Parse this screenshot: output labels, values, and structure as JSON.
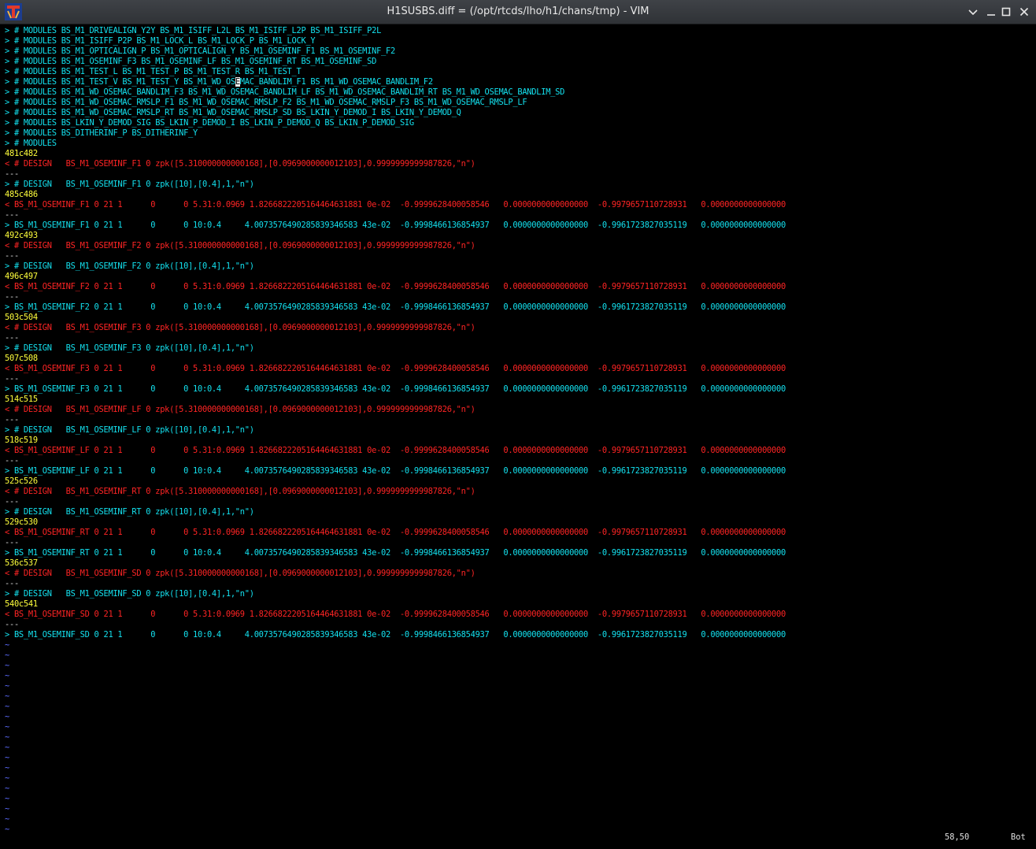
{
  "window": {
    "title": "H1SUSBS.diff = (/opt/rtcds/lho/h1/chans/tmp) - VIM"
  },
  "colors": {
    "added": "#13e1ef",
    "removed": "#ff2424",
    "hunk": "#ffff3c",
    "tilde": "#5c6cff"
  },
  "lines": [
    {
      "type": "add",
      "text": "> # MODULES BS_M1_DRIVEALIGN_Y2Y BS_M1_ISIFF_L2L BS_M1_ISIFF_L2P BS_M1_ISIFF_P2L"
    },
    {
      "type": "add",
      "text": "> # MODULES BS_M1_ISIFF_P2P BS_M1_LOCK_L BS_M1_LOCK_P BS_M1_LOCK_Y"
    },
    {
      "type": "add",
      "text": "> # MODULES BS_M1_OPTICALIGN_P BS_M1_OPTICALIGN_Y BS_M1_OSEMINF_F1 BS_M1_OSEMINF_F2"
    },
    {
      "type": "add",
      "text": "> # MODULES BS_M1_OSEMINF_F3 BS_M1_OSEMINF_LF BS_M1_OSEMINF_RT BS_M1_OSEMINF_SD"
    },
    {
      "type": "add",
      "text": "> # MODULES BS_M1_TEST_L BS_M1_TEST_P BS_M1_TEST_R BS_M1_TEST_T"
    },
    {
      "type": "add",
      "text": "> # MODULES BS_M1_TEST_V BS_M1_TEST_Y BS_M1_WD_OSEMAC_BANDLIM_F1 BS_M1_WD_OSEMAC_BANDLIM_F2",
      "cursor": true,
      "pre": "> # MODULES BS_M1_TEST_V BS_M1_TEST_Y BS_M1_WD_OS",
      "cur": "E",
      "post": "MAC_BANDLIM_F1 BS_M1_WD_OSEMAC_BANDLIM_F2"
    },
    {
      "type": "add",
      "text": "> # MODULES BS_M1_WD_OSEMAC_BANDLIM_F3 BS_M1_WD_OSEMAC_BANDLIM_LF BS_M1_WD_OSEMAC_BANDLIM_RT BS_M1_WD_OSEMAC_BANDLIM_SD"
    },
    {
      "type": "add",
      "text": "> # MODULES BS_M1_WD_OSEMAC_RMSLP_F1 BS_M1_WD_OSEMAC_RMSLP_F2 BS_M1_WD_OSEMAC_RMSLP_F3 BS_M1_WD_OSEMAC_RMSLP_LF"
    },
    {
      "type": "add",
      "text": "> # MODULES BS_M1_WD_OSEMAC_RMSLP_RT BS_M1_WD_OSEMAC_RMSLP_SD BS_LKIN_Y_DEMOD_I BS_LKIN_Y_DEMOD_Q"
    },
    {
      "type": "add",
      "text": "> # MODULES BS_LKIN_Y_DEMOD_SIG BS_LKIN_P_DEMOD_I BS_LKIN_P_DEMOD_Q BS_LKIN_P_DEMOD_SIG"
    },
    {
      "type": "add",
      "text": "> # MODULES BS_DITHERINF_P BS_DITHERINF_Y"
    },
    {
      "type": "add",
      "text": "> # MODULES"
    },
    {
      "type": "hunk",
      "text": "481c482"
    },
    {
      "type": "del",
      "text": "< # DESIGN   BS_M1_OSEMINF_F1 0 zpk([5.310000000000168],[0.0969000000012103],0.9999999999987826,\"n\")"
    },
    {
      "type": "sep",
      "text": "---"
    },
    {
      "type": "add",
      "text": "> # DESIGN   BS_M1_OSEMINF_F1 0 zpk([10],[0.4],1,\"n\")"
    },
    {
      "type": "hunk",
      "text": "485c486"
    },
    {
      "type": "del",
      "text": "< BS_M1_OSEMINF_F1 0 21 1      0      0 5.31:0.0969 1.8266822205164464631881 0e-02  -0.9999628400058546   0.0000000000000000  -0.9979657110728931   0.0000000000000000"
    },
    {
      "type": "sep",
      "text": "---"
    },
    {
      "type": "add",
      "text": "> BS_M1_OSEMINF_F1 0 21 1      0      0 10:0.4     4.0073576490285839346583 43e-02  -0.9998466136854937   0.0000000000000000  -0.9961723827035119   0.0000000000000000"
    },
    {
      "type": "hunk",
      "text": "492c493"
    },
    {
      "type": "del",
      "text": "< # DESIGN   BS_M1_OSEMINF_F2 0 zpk([5.310000000000168],[0.0969000000012103],0.9999999999987826,\"n\")"
    },
    {
      "type": "sep",
      "text": "---"
    },
    {
      "type": "add",
      "text": "> # DESIGN   BS_M1_OSEMINF_F2 0 zpk([10],[0.4],1,\"n\")"
    },
    {
      "type": "hunk",
      "text": "496c497"
    },
    {
      "type": "del",
      "text": "< BS_M1_OSEMINF_F2 0 21 1      0      0 5.31:0.0969 1.8266822205164464631881 0e-02  -0.9999628400058546   0.0000000000000000  -0.9979657110728931   0.0000000000000000"
    },
    {
      "type": "sep",
      "text": "---"
    },
    {
      "type": "add",
      "text": "> BS_M1_OSEMINF_F2 0 21 1      0      0 10:0.4     4.0073576490285839346583 43e-02  -0.9998466136854937   0.0000000000000000  -0.9961723827035119   0.0000000000000000"
    },
    {
      "type": "hunk",
      "text": "503c504"
    },
    {
      "type": "del",
      "text": "< # DESIGN   BS_M1_OSEMINF_F3 0 zpk([5.310000000000168],[0.0969000000012103],0.9999999999987826,\"n\")"
    },
    {
      "type": "sep",
      "text": "---"
    },
    {
      "type": "add",
      "text": "> # DESIGN   BS_M1_OSEMINF_F3 0 zpk([10],[0.4],1,\"n\")"
    },
    {
      "type": "hunk",
      "text": "507c508"
    },
    {
      "type": "del",
      "text": "< BS_M1_OSEMINF_F3 0 21 1      0      0 5.31:0.0969 1.8266822205164464631881 0e-02  -0.9999628400058546   0.0000000000000000  -0.9979657110728931   0.0000000000000000"
    },
    {
      "type": "sep",
      "text": "---"
    },
    {
      "type": "add",
      "text": "> BS_M1_OSEMINF_F3 0 21 1      0      0 10:0.4     4.0073576490285839346583 43e-02  -0.9998466136854937   0.0000000000000000  -0.9961723827035119   0.0000000000000000"
    },
    {
      "type": "hunk",
      "text": "514c515"
    },
    {
      "type": "del",
      "text": "< # DESIGN   BS_M1_OSEMINF_LF 0 zpk([5.310000000000168],[0.0969000000012103],0.9999999999987826,\"n\")"
    },
    {
      "type": "sep",
      "text": "---"
    },
    {
      "type": "add",
      "text": "> # DESIGN   BS_M1_OSEMINF_LF 0 zpk([10],[0.4],1,\"n\")"
    },
    {
      "type": "hunk",
      "text": "518c519"
    },
    {
      "type": "del",
      "text": "< BS_M1_OSEMINF_LF 0 21 1      0      0 5.31:0.0969 1.8266822205164464631881 0e-02  -0.9999628400058546   0.0000000000000000  -0.9979657110728931   0.0000000000000000"
    },
    {
      "type": "sep",
      "text": "---"
    },
    {
      "type": "add",
      "text": "> BS_M1_OSEMINF_LF 0 21 1      0      0 10:0.4     4.0073576490285839346583 43e-02  -0.9998466136854937   0.0000000000000000  -0.9961723827035119   0.0000000000000000"
    },
    {
      "type": "hunk",
      "text": "525c526"
    },
    {
      "type": "del",
      "text": "< # DESIGN   BS_M1_OSEMINF_RT 0 zpk([5.310000000000168],[0.0969000000012103],0.9999999999987826,\"n\")"
    },
    {
      "type": "sep",
      "text": "---"
    },
    {
      "type": "add",
      "text": "> # DESIGN   BS_M1_OSEMINF_RT 0 zpk([10],[0.4],1,\"n\")"
    },
    {
      "type": "hunk",
      "text": "529c530"
    },
    {
      "type": "del",
      "text": "< BS_M1_OSEMINF_RT 0 21 1      0      0 5.31:0.0969 1.8266822205164464631881 0e-02  -0.9999628400058546   0.0000000000000000  -0.9979657110728931   0.0000000000000000"
    },
    {
      "type": "sep",
      "text": "---"
    },
    {
      "type": "add",
      "text": "> BS_M1_OSEMINF_RT 0 21 1      0      0 10:0.4     4.0073576490285839346583 43e-02  -0.9998466136854937   0.0000000000000000  -0.9961723827035119   0.0000000000000000"
    },
    {
      "type": "hunk",
      "text": "536c537"
    },
    {
      "type": "del",
      "text": "< # DESIGN   BS_M1_OSEMINF_SD 0 zpk([5.310000000000168],[0.0969000000012103],0.9999999999987826,\"n\")"
    },
    {
      "type": "sep",
      "text": "---"
    },
    {
      "type": "add",
      "text": "> # DESIGN   BS_M1_OSEMINF_SD 0 zpk([10],[0.4],1,\"n\")"
    },
    {
      "type": "hunk",
      "text": "540c541"
    },
    {
      "type": "del",
      "text": "< BS_M1_OSEMINF_SD 0 21 1      0      0 5.31:0.0969 1.8266822205164464631881 0e-02  -0.9999628400058546   0.0000000000000000  -0.9979657110728931   0.0000000000000000"
    },
    {
      "type": "sep",
      "text": "---"
    },
    {
      "type": "add",
      "text": "> BS_M1_OSEMINF_SD 0 21 1      0      0 10:0.4     4.0073576490285839346583 43e-02  -0.9998466136854937   0.0000000000000000  -0.9961723827035119   0.0000000000000000"
    },
    {
      "type": "tilde",
      "text": "~"
    },
    {
      "type": "tilde",
      "text": "~"
    },
    {
      "type": "tilde",
      "text": "~"
    },
    {
      "type": "tilde",
      "text": "~"
    },
    {
      "type": "tilde",
      "text": "~"
    },
    {
      "type": "tilde",
      "text": "~"
    },
    {
      "type": "tilde",
      "text": "~"
    },
    {
      "type": "tilde",
      "text": "~"
    },
    {
      "type": "tilde",
      "text": "~"
    },
    {
      "type": "tilde",
      "text": "~"
    },
    {
      "type": "tilde",
      "text": "~"
    },
    {
      "type": "tilde",
      "text": "~"
    },
    {
      "type": "tilde",
      "text": "~"
    },
    {
      "type": "tilde",
      "text": "~"
    },
    {
      "type": "tilde",
      "text": "~"
    },
    {
      "type": "tilde",
      "text": "~"
    },
    {
      "type": "tilde",
      "text": "~"
    },
    {
      "type": "tilde",
      "text": "~"
    },
    {
      "type": "tilde",
      "text": "~"
    }
  ],
  "status": {
    "position": "58,50",
    "scroll": "Bot"
  }
}
